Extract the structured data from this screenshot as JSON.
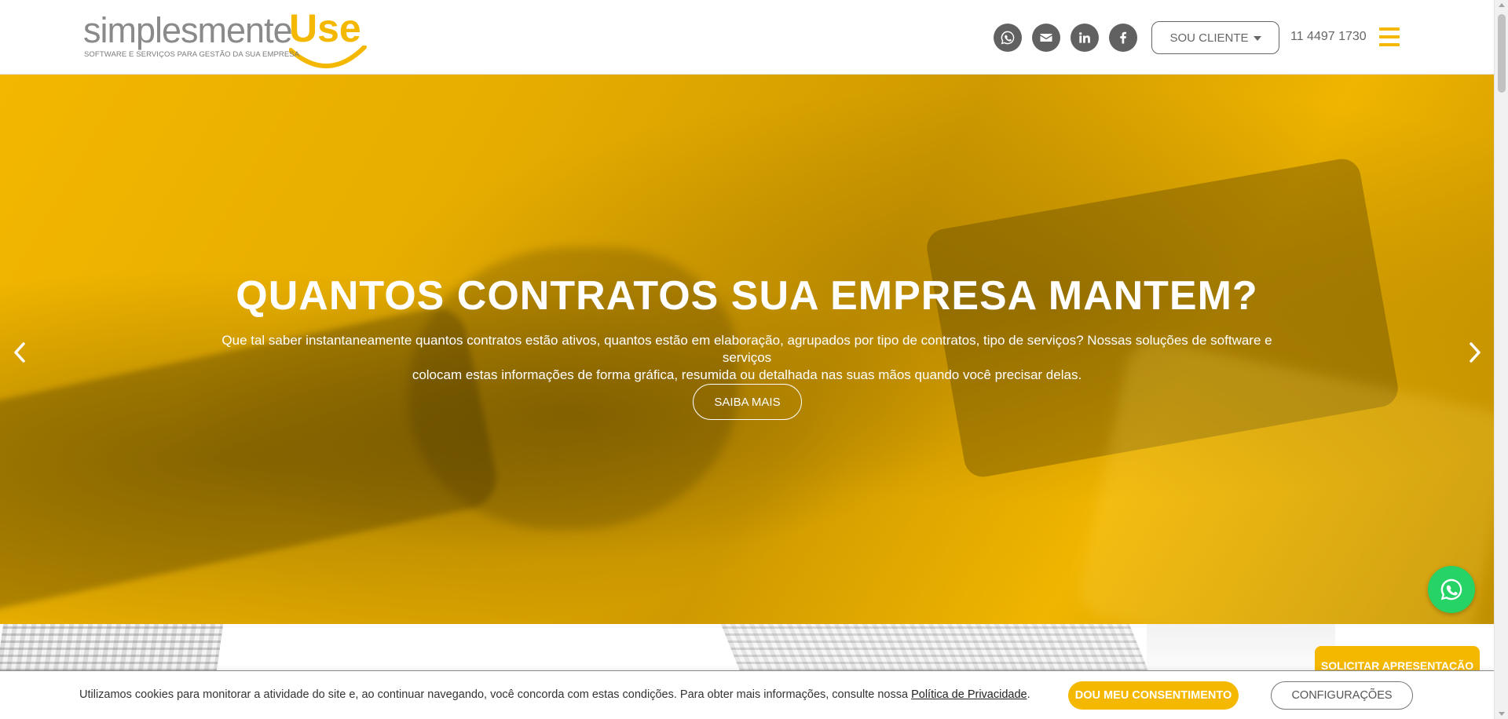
{
  "brand": {
    "name_part1": "simplesmente",
    "name_part2": "Use",
    "tagline": "SOFTWARE E SERVIÇOS PARA GESTÃO DA SUA EMPRESA",
    "accent_color": "#f5b800"
  },
  "header": {
    "social_icons": [
      "whatsapp-icon",
      "email-icon",
      "linkedin-icon",
      "facebook-icon"
    ],
    "client_button_label": "SOU CLIENTE",
    "phone": "11 4497 1730"
  },
  "hero": {
    "title": "QUANTOS CONTRATOS SUA EMPRESA MANTEM?",
    "text_line1": "Que tal saber instantaneamente quantos contratos estão ativos, quantos estão em elaboração, agrupados por tipo de contratos, tipo de serviços? Nossas soluções de software e serviços",
    "text_line2": "colocam estas informações de forma gráfica, resumida ou detalhada nas suas mãos quando você precisar delas.",
    "button_label": "SAIBA MAIS"
  },
  "floating": {
    "presentation_label": "SOLICITAR APRESENTAÇÃO"
  },
  "cookie": {
    "text": "Utilizamos cookies para monitorar a atividade do site e, ao continuar navegando, você concorda com estas condições. Para obter mais informações, consulte nossa ",
    "link_label": "Política de Privacidade",
    "after_link": ".",
    "consent_label": "DOU MEU CONSENTIMENTO",
    "config_label": "CONFIGURAÇÕES"
  }
}
